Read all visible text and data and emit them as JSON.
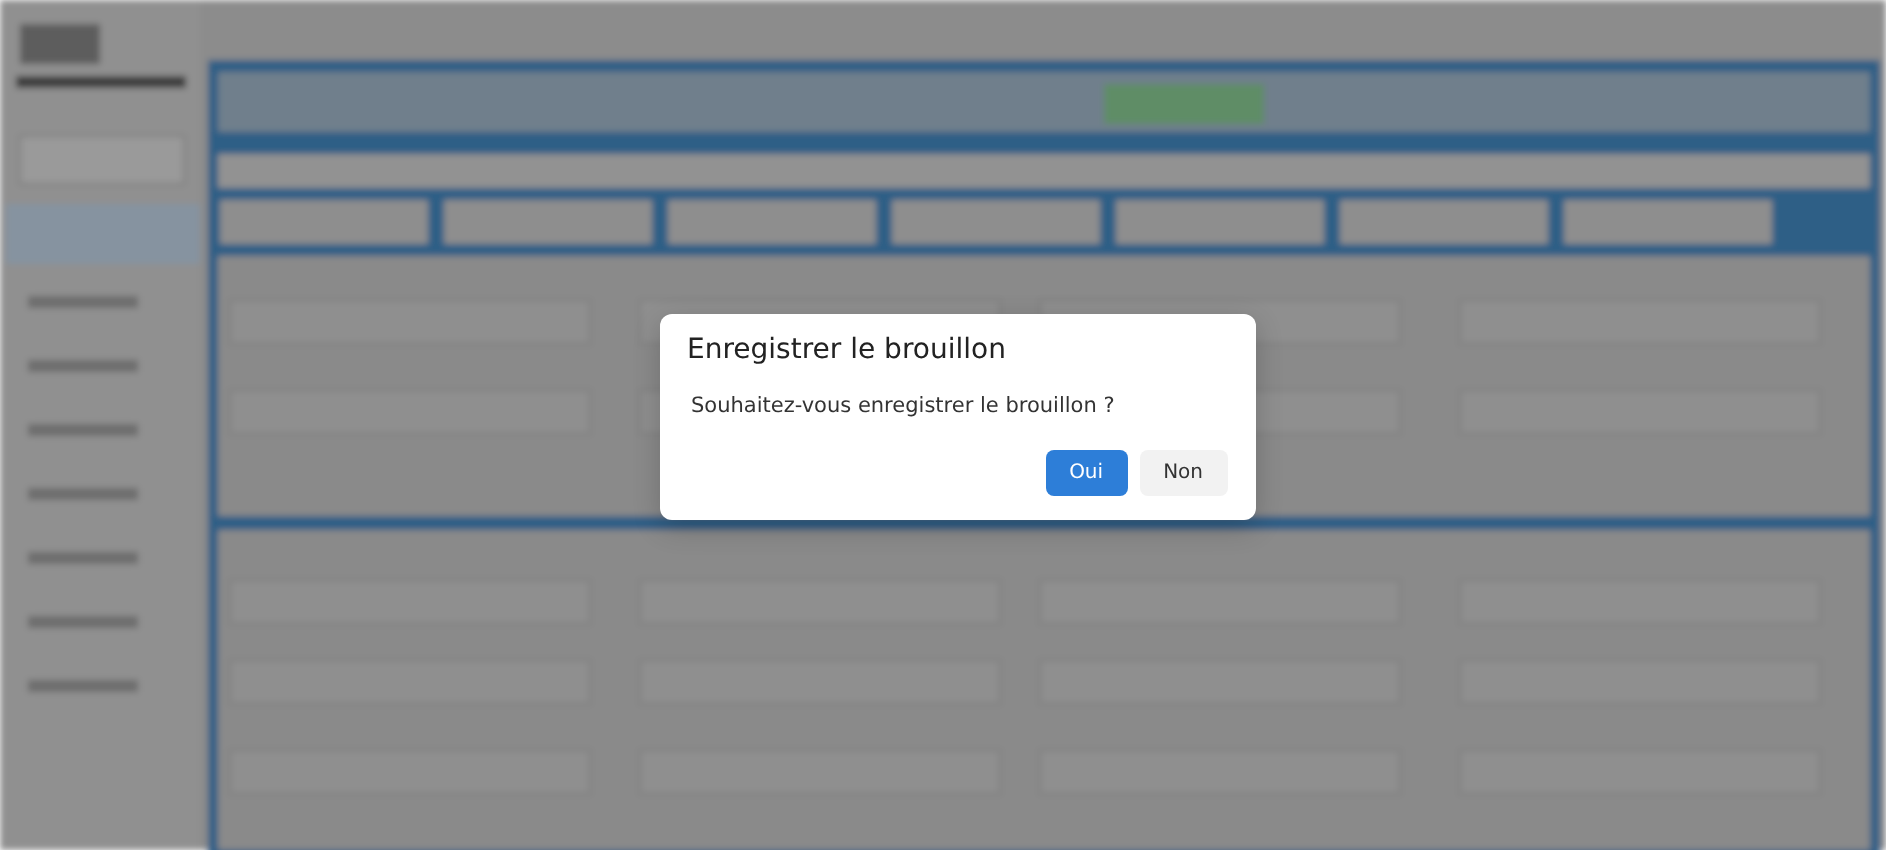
{
  "dialog": {
    "title": "Enregistrer le brouillon",
    "message": "Souhaitez-vous enregistrer le brouillon ?",
    "buttons": [
      {
        "label": "Oui",
        "kind": "primary"
      },
      {
        "label": "Non",
        "kind": "secondary"
      }
    ]
  }
}
